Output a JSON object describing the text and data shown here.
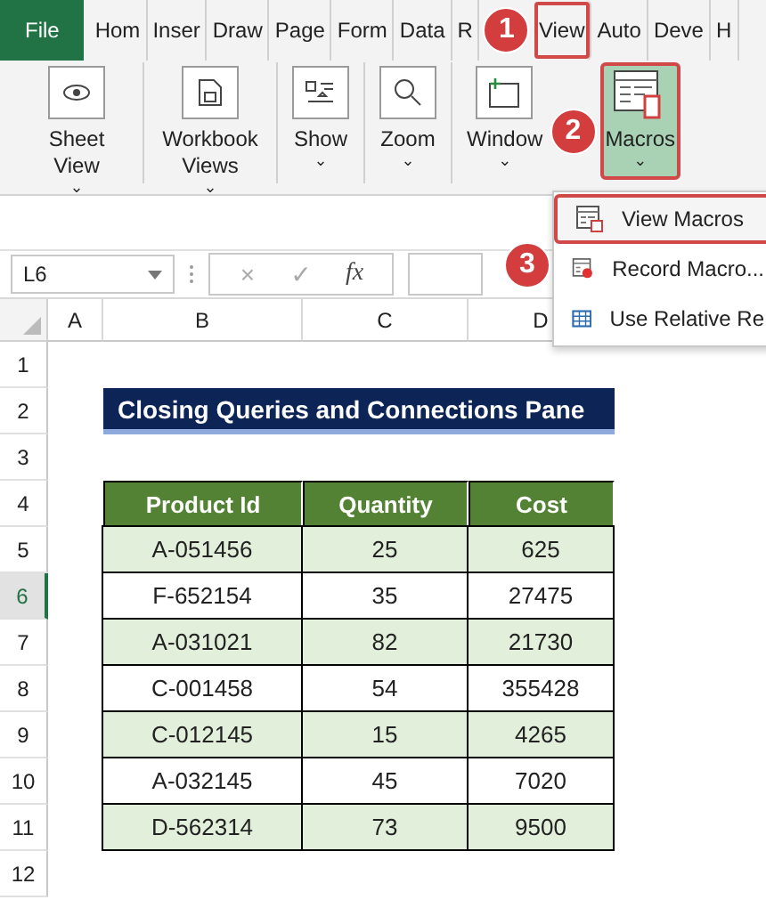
{
  "ribbon_tabs": [
    {
      "label": "File",
      "kind": "file",
      "selected": false
    },
    {
      "label": "Hom",
      "kind": "tab",
      "selected": false
    },
    {
      "label": "Inser",
      "kind": "tab",
      "selected": false
    },
    {
      "label": "Draw",
      "kind": "tab",
      "selected": false
    },
    {
      "label": "Page",
      "kind": "tab",
      "selected": false
    },
    {
      "label": "Form",
      "kind": "tab",
      "selected": false
    },
    {
      "label": "Data",
      "kind": "tab",
      "selected": false
    },
    {
      "label": "R",
      "kind": "tab",
      "selected": false
    },
    {
      "label": "View",
      "kind": "tab",
      "selected": true
    },
    {
      "label": "Auto",
      "kind": "tab",
      "selected": false
    },
    {
      "label": "Deve",
      "kind": "tab",
      "selected": false
    },
    {
      "label": "H",
      "kind": "tab",
      "selected": false
    }
  ],
  "ribbon_groups": [
    {
      "label": "Sheet View",
      "caret": "⌄",
      "selected": false
    },
    {
      "label": "Workbook Views",
      "caret": "⌄",
      "selected": false
    },
    {
      "label": "Show",
      "caret": "⌄",
      "selected": false
    },
    {
      "label": "Zoom",
      "caret": "⌄",
      "selected": false
    },
    {
      "label": "Window",
      "caret": "⌄",
      "selected": false
    },
    {
      "label": "Macros",
      "caret": "⌄",
      "selected": true
    }
  ],
  "macros_menu": [
    {
      "label": "View Macros",
      "selected": true
    },
    {
      "label": "Record Macro...",
      "selected": false
    },
    {
      "label": "Use Relative Re",
      "selected": false
    }
  ],
  "formula_bar": {
    "name_box": "L6",
    "cancel": "×",
    "enter": "✓",
    "function": "fx"
  },
  "sheet": {
    "columns": [
      "A",
      "B",
      "C",
      "D"
    ],
    "rows": [
      {
        "label": "1",
        "selected": false
      },
      {
        "label": "2",
        "selected": false
      },
      {
        "label": "3",
        "selected": false
      },
      {
        "label": "4",
        "selected": false
      },
      {
        "label": "5",
        "selected": false
      },
      {
        "label": "6",
        "selected": true
      },
      {
        "label": "7",
        "selected": false
      },
      {
        "label": "8",
        "selected": false
      },
      {
        "label": "9",
        "selected": false
      },
      {
        "label": "10",
        "selected": false
      },
      {
        "label": "11",
        "selected": false
      },
      {
        "label": "12",
        "selected": false
      }
    ],
    "title": "Closing Queries and Connections Pane",
    "table": {
      "columns": [
        "Product Id",
        "Quantity",
        "Cost"
      ],
      "rows": [
        [
          "A-051456",
          "25",
          "625"
        ],
        [
          "F-652154",
          "35",
          "27475"
        ],
        [
          "A-031021",
          "82",
          "21730"
        ],
        [
          "C-001458",
          "54",
          "355428"
        ],
        [
          "C-012145",
          "15",
          "4265"
        ],
        [
          "A-032145",
          "45",
          "7020"
        ],
        [
          "D-562314",
          "73",
          "9500"
        ]
      ]
    }
  },
  "callouts": [
    {
      "label": "1"
    },
    {
      "label": "2"
    },
    {
      "label": "3"
    }
  ]
}
